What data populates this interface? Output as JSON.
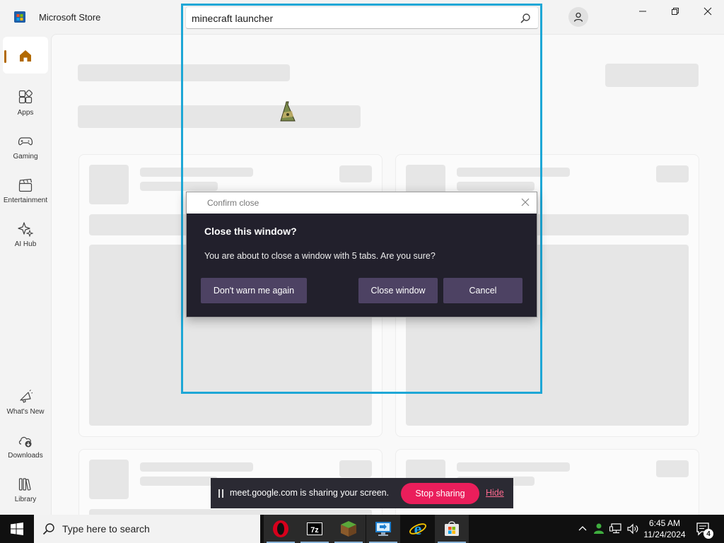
{
  "app": {
    "name": "Microsoft Store",
    "brand_color": "#b26a00"
  },
  "search": {
    "value": "minecraft launcher",
    "icon": "search-icon"
  },
  "window_controls": [
    "minimize",
    "restore",
    "close"
  ],
  "sidebar": {
    "items": [
      {
        "label": "",
        "icon": "home-icon",
        "active": true
      },
      {
        "label": "Apps",
        "icon": "apps-icon"
      },
      {
        "label": "Gaming",
        "icon": "gamepad-icon"
      },
      {
        "label": "Entertainment",
        "icon": "clapper-icon"
      },
      {
        "label": "AI Hub",
        "icon": "sparkle-icon"
      },
      {
        "label": "What's New",
        "icon": "megaphone-icon"
      },
      {
        "label": "Downloads",
        "icon": "downloads-icon"
      },
      {
        "label": "Library",
        "icon": "library-icon"
      }
    ]
  },
  "dialog": {
    "title": "Confirm close",
    "heading": "Close this window?",
    "message": "You are about to close a window with 5 tabs. Are you sure?",
    "buttons": {
      "dont_warn": "Don't warn me again",
      "close_window": "Close window",
      "cancel": "Cancel"
    },
    "background_color": "#22202c",
    "button_color": "#4d4263"
  },
  "sharing_bar": {
    "message": "meet.google.com is sharing your screen.",
    "stop_label": "Stop sharing",
    "hide_label": "Hide",
    "stop_color": "#ea1e5b"
  },
  "taskbar": {
    "search_placeholder": "Type here to search",
    "apps": [
      "opera-icon",
      "7zip-icon",
      "minecraft-icon",
      "remote-desktop-icon",
      "internet-explorer-icon",
      "microsoft-store-icon"
    ],
    "clock": {
      "time": "6:45 AM",
      "date": "11/24/2024"
    },
    "notification_count": "4"
  },
  "highlight_color": "#1ea7d6"
}
